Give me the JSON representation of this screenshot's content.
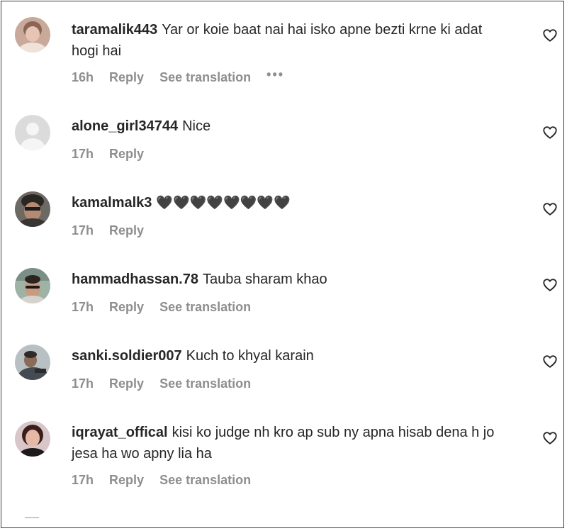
{
  "comments": [
    {
      "username": "taramalik443",
      "text": "Yar or koie baat nai hai isko apne bezti krne ki adat hogi hai",
      "time": "16h",
      "reply": "Reply",
      "translate": "See translation",
      "more": "•••",
      "avatar_icon": "avatar-photo-icon"
    },
    {
      "username": "alone_girl34744",
      "text": "Nice",
      "time": "17h",
      "reply": "Reply",
      "avatar_icon": "default-avatar-icon"
    },
    {
      "username": "kamalmalk3",
      "text": "🖤🖤🖤🖤🖤🖤🖤🖤",
      "time": "17h",
      "reply": "Reply",
      "avatar_icon": "avatar-photo-icon"
    },
    {
      "username": "hammadhassan.78",
      "text": "Tauba sharam khao",
      "time": "17h",
      "reply": "Reply",
      "translate": "See translation",
      "avatar_icon": "avatar-photo-icon"
    },
    {
      "username": "sanki.soldier007",
      "text": "Kuch to khyal karain",
      "time": "17h",
      "reply": "Reply",
      "translate": "See translation",
      "avatar_icon": "avatar-photo-icon"
    },
    {
      "username": "iqrayat_offical",
      "text": "kisi ko judge nh kro ap sub ny apna hisab dena h jo jesa ha wo apny lia ha",
      "time": "17h",
      "reply": "Reply",
      "translate": "See translation",
      "avatar_icon": "avatar-photo-icon"
    }
  ],
  "colors": {
    "text": "#262626",
    "meta": "#8e8e8e",
    "border": "#3a3a3a"
  },
  "icons": {
    "like": "heart-outline-icon"
  }
}
